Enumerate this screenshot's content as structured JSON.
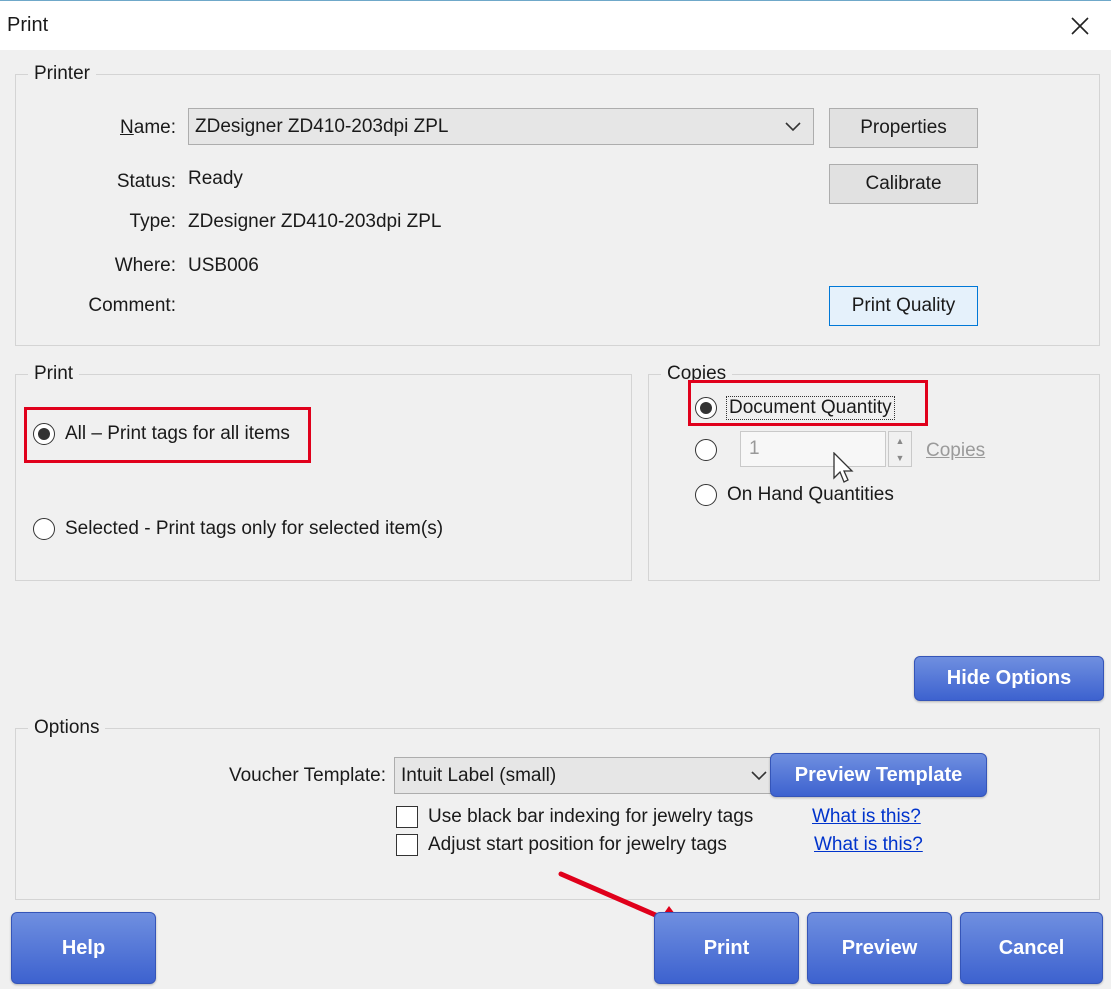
{
  "window": {
    "title": "Print",
    "close_icon": "close-icon"
  },
  "printer": {
    "legend": "Printer",
    "name_label": "Name:",
    "name_value": "ZDesigner ZD410-203dpi ZPL",
    "status_label": "Status:",
    "status_value": "Ready",
    "type_label": "Type:",
    "type_value": "ZDesigner ZD410-203dpi ZPL",
    "where_label": "Where:",
    "where_value": "USB006",
    "comment_label": "Comment:",
    "properties_label": "Properties",
    "calibrate_label": "Calibrate",
    "print_quality_label": "Print Quality"
  },
  "print_group": {
    "legend": "Print",
    "all_label": "All – Print tags for all items",
    "all_selected": true,
    "selected_label": "Selected - Print tags only for selected item(s)",
    "selected_selected": false
  },
  "copies_group": {
    "legend": "Copies",
    "document_quantity_label": "Document Quantity",
    "document_quantity_selected": true,
    "copies_value": "1",
    "copies_label": "Copies",
    "on_hand_label": "On Hand Quantities"
  },
  "hide_options_label": "Hide Options",
  "options": {
    "legend": "Options",
    "voucher_template_label": "Voucher Template:",
    "voucher_template_value": "Intuit Label (small)",
    "preview_template_label": "Preview Template",
    "black_bar_label": "Use black bar indexing for jewelry tags",
    "black_bar_checked": false,
    "adjust_start_label": "Adjust start position for jewelry tags",
    "adjust_start_checked": false,
    "what_is_this_1": "What is this?",
    "what_is_this_2": "What is this?"
  },
  "footer": {
    "help_label": "Help",
    "print_label": "Print",
    "preview_label": "Preview",
    "cancel_label": "Cancel"
  },
  "colors": {
    "highlight_red": "#e0001b",
    "button_blue": "#4a6fd6",
    "link_blue": "#0033cc"
  }
}
